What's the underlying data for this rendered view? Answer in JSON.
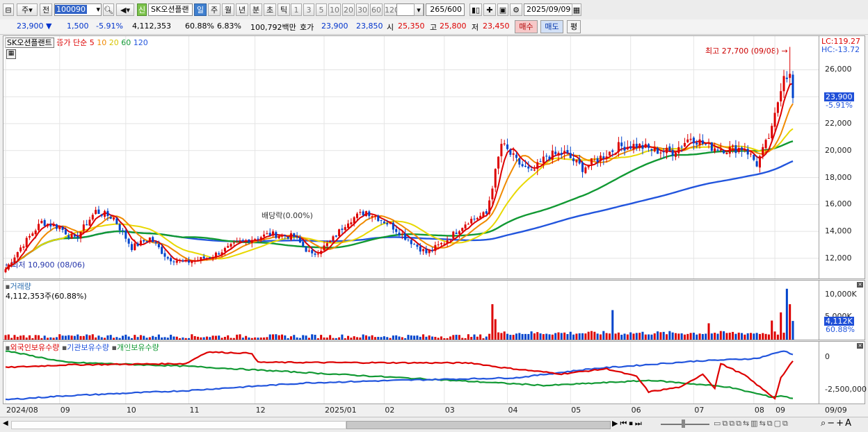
{
  "toolbar": {
    "period": "주",
    "prev": "전",
    "code": "100090",
    "credit": "신",
    "name": "SK오션플랜",
    "timeframes": [
      "일",
      "주",
      "월",
      "년",
      "분",
      "초",
      "틱"
    ],
    "numbers": [
      "1",
      "3",
      "5",
      "10",
      "20",
      "30",
      "60",
      "120"
    ],
    "count": "265",
    "count_total": "/600",
    "date": "2025/09/09"
  },
  "quote": {
    "price": "23,900",
    "change": "1,500",
    "change_pct": "-5.91%",
    "volume": "4,112,353",
    "vol_ratio": "60.88%",
    "turnover": "6.83%",
    "amount": "100,792백만",
    "ask_label": "호가",
    "ask": "23,900",
    "bid": "23,850",
    "open_label": "시",
    "open": "25,350",
    "high_label": "고",
    "high": "25,800",
    "low_label": "저",
    "low": "23,450",
    "buy": "매수",
    "sell": "매도",
    "eval": "평"
  },
  "colors": {
    "up": "#dd0000",
    "down": "#0044cc",
    "ma5": "#dd0000",
    "ma10": "#f08a00",
    "ma20": "#e8d800",
    "ma60": "#119933",
    "ma120": "#2255dd",
    "foreign": "#dd0000",
    "inst": "#2255dd",
    "indiv": "#119933"
  },
  "chart_data": [
    {
      "type": "candlestick",
      "title": "SK오션플랜트",
      "legend": [
        "종가 단순",
        "5",
        "10",
        "20",
        "60",
        "120"
      ],
      "ylim": [
        10500,
        28500
      ],
      "yticks": [
        "12,000",
        "14,000",
        "16,000",
        "18,000",
        "20,000",
        "22,000",
        "24,000",
        "26,000"
      ],
      "ytick_values": [
        12000,
        14000,
        16000,
        18000,
        20000,
        22000,
        24000,
        26000
      ],
      "x_labels": [
        "2024/08",
        "09",
        "10",
        "11",
        "12",
        "2025/01",
        "02",
        "03",
        "04",
        "05",
        "06",
        "07",
        "08",
        "09",
        "09/09"
      ],
      "annotations": {
        "high": "최고 27,700 (09/08)",
        "low": "최저 10,900 (08/06)",
        "dividend": "배당락(0.00%)",
        "lc": "LC:119.27",
        "hc": "HC:-13.72",
        "last_price": "23,900",
        "last_change": "-5.91%"
      },
      "anchors": [
        {
          "i": 0,
          "p": 11200
        },
        {
          "i": 5,
          "p": 12800
        },
        {
          "i": 12,
          "p": 14700
        },
        {
          "i": 18,
          "p": 14300
        },
        {
          "i": 23,
          "p": 13400
        },
        {
          "i": 30,
          "p": 15500
        },
        {
          "i": 36,
          "p": 15000
        },
        {
          "i": 42,
          "p": 12800
        },
        {
          "i": 48,
          "p": 13500
        },
        {
          "i": 54,
          "p": 12000
        },
        {
          "i": 60,
          "p": 11700
        },
        {
          "i": 68,
          "p": 12100
        },
        {
          "i": 78,
          "p": 13200
        },
        {
          "i": 88,
          "p": 13800
        },
        {
          "i": 96,
          "p": 13600
        },
        {
          "i": 102,
          "p": 12200
        },
        {
          "i": 108,
          "p": 13200
        },
        {
          "i": 114,
          "p": 14800
        },
        {
          "i": 120,
          "p": 15500
        },
        {
          "i": 128,
          "p": 14500
        },
        {
          "i": 134,
          "p": 13400
        },
        {
          "i": 140,
          "p": 12400
        },
        {
          "i": 146,
          "p": 13200
        },
        {
          "i": 154,
          "p": 14800
        },
        {
          "i": 160,
          "p": 15300
        },
        {
          "i": 165,
          "p": 20500
        },
        {
          "i": 170,
          "p": 19200
        },
        {
          "i": 175,
          "p": 18300
        },
        {
          "i": 180,
          "p": 19600
        },
        {
          "i": 186,
          "p": 19800
        },
        {
          "i": 192,
          "p": 18700
        },
        {
          "i": 198,
          "p": 19500
        },
        {
          "i": 204,
          "p": 20300
        },
        {
          "i": 210,
          "p": 20400
        },
        {
          "i": 216,
          "p": 20000
        },
        {
          "i": 222,
          "p": 19900
        },
        {
          "i": 228,
          "p": 21000
        },
        {
          "i": 234,
          "p": 20300
        },
        {
          "i": 240,
          "p": 20100
        },
        {
          "i": 246,
          "p": 20200
        },
        {
          "i": 250,
          "p": 19000
        },
        {
          "i": 255,
          "p": 21500
        },
        {
          "i": 259,
          "p": 25800
        },
        {
          "i": 261,
          "p": 25500
        },
        {
          "i": 262,
          "p": 23900
        }
      ]
    },
    {
      "type": "bar",
      "title": "거래량",
      "value_label": "4,112,353주(60.88%)",
      "ylim": [
        0,
        13000000
      ],
      "yticks": [
        "10,000K",
        "5,000K"
      ],
      "ytick_values": [
        10000000,
        5000000
      ],
      "last_value": "4,112K",
      "last_ratio": "60.88%",
      "spikes": [
        {
          "i": 162,
          "v": 7800000
        },
        {
          "i": 163,
          "v": 4500000
        },
        {
          "i": 202,
          "v": 6500000
        },
        {
          "i": 234,
          "v": 3600000
        },
        {
          "i": 255,
          "v": 4200000
        },
        {
          "i": 258,
          "v": 6000000
        },
        {
          "i": 260,
          "v": 11200000
        },
        {
          "i": 261,
          "v": 7800000
        },
        {
          "i": 262,
          "v": 4112000
        }
      ]
    },
    {
      "type": "line",
      "series_names": [
        "외국인보유수량",
        "기관보유수량",
        "개인보유수량"
      ],
      "ylim": [
        -3600000,
        1200000
      ],
      "yticks": [
        "0",
        "-2,500,000"
      ],
      "ytick_values": [
        0,
        -2500000
      ]
    }
  ]
}
